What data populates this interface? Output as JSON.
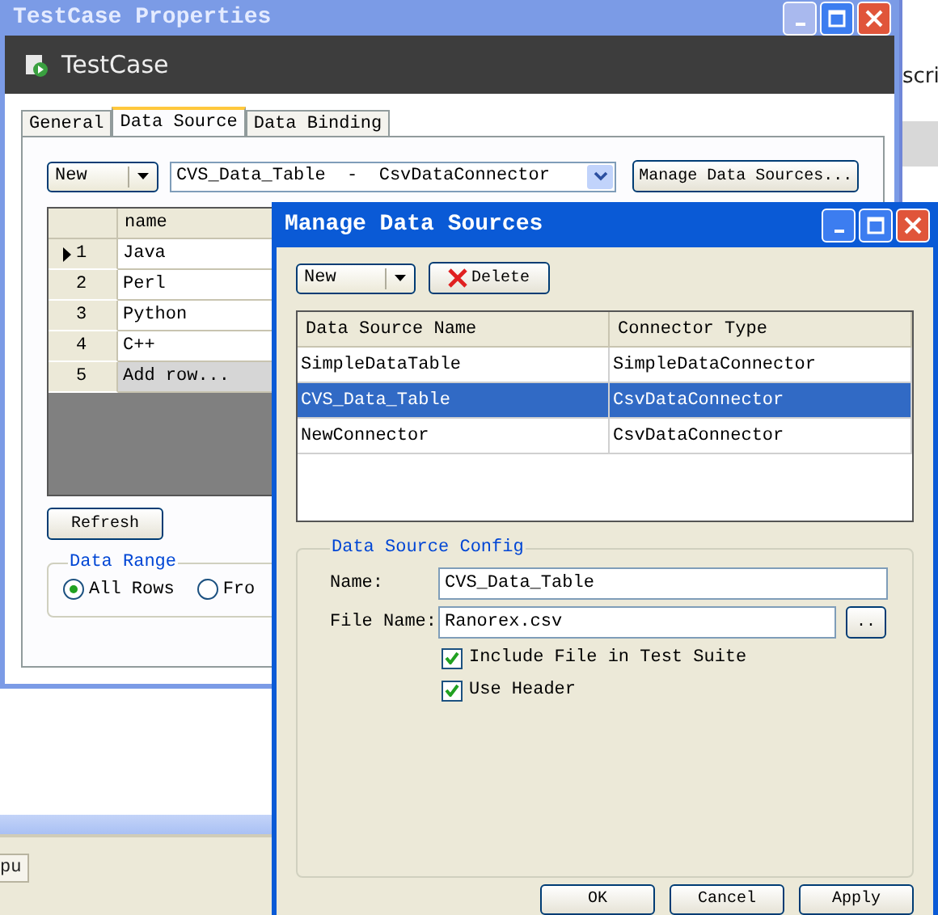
{
  "main_window": {
    "title": "TestCase Properties",
    "header": "TestCase",
    "tabs": [
      {
        "label": "General",
        "selected": false
      },
      {
        "label": "Data Source",
        "selected": true
      },
      {
        "label": "Data Binding",
        "selected": false
      }
    ],
    "new_button": {
      "label": "New"
    },
    "source_select": "CVS_Data_Table  -  CsvDataConnector",
    "manage_button": {
      "label": "Manage Data Sources..."
    },
    "grid": {
      "columns": [
        "name"
      ],
      "rows": [
        {
          "number": "1",
          "value": "Java",
          "current": true,
          "kind": "data"
        },
        {
          "number": "2",
          "value": "Perl",
          "current": false,
          "kind": "data"
        },
        {
          "number": "3",
          "value": "Python",
          "current": false,
          "kind": "data"
        },
        {
          "number": "4",
          "value": "C++",
          "current": false,
          "kind": "data"
        },
        {
          "number": "5",
          "value": "Add row...",
          "current": false,
          "kind": "new"
        }
      ]
    },
    "refresh_button": {
      "label": "Refresh"
    },
    "data_range": {
      "title": "Data Range",
      "options": [
        {
          "label": "All Rows",
          "selected": true
        },
        {
          "label": "Fro",
          "selected": false
        }
      ]
    }
  },
  "dialog": {
    "title": "Manage Data Sources",
    "new_button": {
      "label": "New"
    },
    "delete_button": {
      "label": "Delete"
    },
    "table": {
      "columns": [
        "Data Source Name",
        "Connector Type"
      ],
      "rows": [
        {
          "cells": [
            "SimpleDataTable",
            "SimpleDataConnector"
          ],
          "selected": false
        },
        {
          "cells": [
            "CVS_Data_Table",
            "CsvDataConnector"
          ],
          "selected": true
        },
        {
          "cells": [
            "NewConnector",
            "CsvDataConnector"
          ],
          "selected": false
        }
      ]
    },
    "config": {
      "title": "Data Source Config",
      "name_label": "Name:",
      "name_value": "CVS_Data_Table",
      "file_label": "File Name:",
      "file_value": "Ranorex.csv",
      "browse_button": "..",
      "checkboxes": [
        {
          "label": "Include File in Test Suite",
          "checked": true
        },
        {
          "label": "Use Header",
          "checked": true
        }
      ]
    },
    "buttons": [
      {
        "label": "OK"
      },
      {
        "label": "Cancel"
      },
      {
        "label": "Apply"
      }
    ]
  },
  "background": {
    "side_text": "scri",
    "tab": "pu"
  }
}
